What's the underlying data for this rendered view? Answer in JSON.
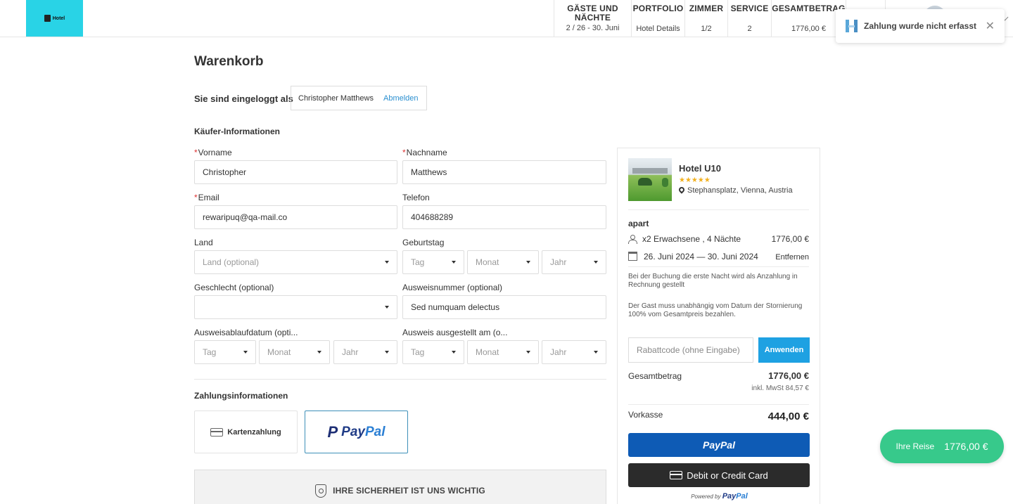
{
  "header": {
    "logo_text": "Hotel",
    "nav": [
      {
        "heading": "GÄSTE UND NÄCHTE",
        "value": "2 / 26 - 30. Juni"
      },
      {
        "heading": "PORTFOLIO",
        "value": "Hotel Details"
      },
      {
        "heading": "ZIMMER",
        "value": "1/2"
      },
      {
        "heading": "SERVICE",
        "value": "2"
      },
      {
        "heading": "GESAMTBETRAG",
        "value": "1776,00 €"
      }
    ]
  },
  "toast": {
    "message": "Zahlung wurde nicht erfasst",
    "close": "✕"
  },
  "page": {
    "title": "Warenkorb",
    "logged_in_label": "Sie sind eingeloggt als",
    "user_name": "Christopher Matthews",
    "logout_label": "Abmelden"
  },
  "buyer": {
    "section_title": "Käufer-Informationen",
    "first_name": {
      "label": "Vorname",
      "value": "Christopher"
    },
    "last_name": {
      "label": "Nachname",
      "value": "Matthews"
    },
    "email": {
      "label": "Email",
      "value": "rewaripuq@qa-mail.co"
    },
    "phone": {
      "label": "Telefon",
      "value": "404688289"
    },
    "country": {
      "label": "Land",
      "placeholder": "Land (optional)"
    },
    "birthday": {
      "label": "Geburtstag",
      "day": "Tag",
      "month": "Monat",
      "year": "Jahr"
    },
    "gender": {
      "label": "Geschlecht (optional)",
      "value": ""
    },
    "id_number": {
      "label": "Ausweisnummer (optional)",
      "value": "Sed numquam delectus"
    },
    "id_expiry": {
      "label": "Ausweisablaufdatum (opti...",
      "day": "Tag",
      "month": "Monat",
      "year": "Jahr"
    },
    "id_issued": {
      "label": "Ausweis ausgestellt am (o...",
      "day": "Tag",
      "month": "Monat",
      "year": "Jahr"
    }
  },
  "payment": {
    "section_title": "Zahlungsinformationen",
    "card_label": "Kartenzahlung",
    "paypal_pay": "Pay",
    "paypal_pal": "Pal",
    "security_text": "IHRE SICHERHEIT IST UNS WICHTIG"
  },
  "summary": {
    "hotel_name": "Hotel U10",
    "stars": "★★★★★",
    "address": "Stephansplatz, Vienna, Austria",
    "room_type": "apart",
    "guests_nights": "x2 Erwachsene , 4 Nächte",
    "room_price": "1776,00 €",
    "dates": "26. Juni 2024 — 30. Juni 2024",
    "remove_label": "Entfernen",
    "note_deposit": "Bei der Buchung die erste Nacht wird als Anzahlung in Rechnung gestellt",
    "note_cancel": "Der Gast muss unabhängig vom Datum der Stornierung 100% vom Gesamtpreis bezahlen.",
    "coupon_placeholder": "Rabattcode (ohne Eingabe)",
    "apply_label": "Anwenden",
    "total_label": "Gesamtbetrag",
    "total_value": "1776,00 €",
    "vat_text": "inkl. MwSt 84,57 €",
    "prepay_label": "Vorkasse",
    "prepay_value": "444,00 €",
    "paypal_button": "PayPal",
    "card_button": "Debit or Credit Card",
    "powered_by": "Powered by",
    "powered_pay": "Pay",
    "powered_pal": "Pal"
  },
  "trip": {
    "label": "Ihre Reise",
    "value": "1776,00 €"
  }
}
